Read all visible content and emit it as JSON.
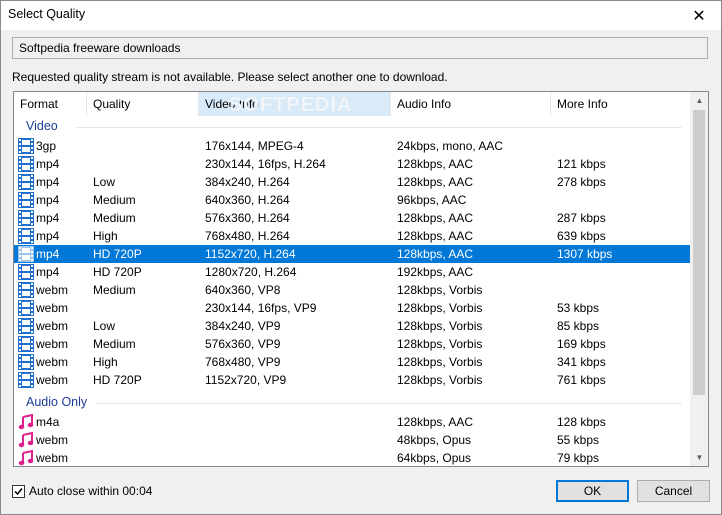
{
  "window": {
    "title": "Select Quality",
    "close_glyph": "✕"
  },
  "url_text": "Softpedia freeware downloads",
  "message": "Requested quality stream is not available. Please select another one to download.",
  "columns": [
    "Format",
    "Quality",
    "Video Info",
    "Audio Info",
    "More Info"
  ],
  "watermark": "SOFTPEDIA",
  "groups": {
    "video": "Video",
    "audio": "Audio Only"
  },
  "video_rows": [
    {
      "format": "3gp",
      "quality": "",
      "video": "176x144, MPEG-4",
      "audio": "24kbps, mono, AAC",
      "more": ""
    },
    {
      "format": "mp4",
      "quality": "",
      "video": "230x144, 16fps, H.264",
      "audio": "128kbps, AAC",
      "more": "121 kbps"
    },
    {
      "format": "mp4",
      "quality": "Low",
      "video": "384x240, H.264",
      "audio": "128kbps, AAC",
      "more": "278 kbps"
    },
    {
      "format": "mp4",
      "quality": "Medium",
      "video": "640x360, H.264",
      "audio": "96kbps, AAC",
      "more": ""
    },
    {
      "format": "mp4",
      "quality": "Medium",
      "video": "576x360, H.264",
      "audio": "128kbps, AAC",
      "more": "287 kbps"
    },
    {
      "format": "mp4",
      "quality": "High",
      "video": "768x480, H.264",
      "audio": "128kbps, AAC",
      "more": "639 kbps"
    },
    {
      "format": "mp4",
      "quality": "HD 720P",
      "video": "1152x720, H.264",
      "audio": "128kbps, AAC",
      "more": "1307 kbps"
    },
    {
      "format": "mp4",
      "quality": "HD 720P",
      "video": "1280x720, H.264",
      "audio": "192kbps, AAC",
      "more": ""
    },
    {
      "format": "webm",
      "quality": "Medium",
      "video": "640x360, VP8",
      "audio": "128kbps, Vorbis",
      "more": ""
    },
    {
      "format": "webm",
      "quality": "",
      "video": "230x144, 16fps, VP9",
      "audio": "128kbps, Vorbis",
      "more": "53 kbps"
    },
    {
      "format": "webm",
      "quality": "Low",
      "video": "384x240, VP9",
      "audio": "128kbps, Vorbis",
      "more": "85 kbps"
    },
    {
      "format": "webm",
      "quality": "Medium",
      "video": "576x360, VP9",
      "audio": "128kbps, Vorbis",
      "more": "169 kbps"
    },
    {
      "format": "webm",
      "quality": "High",
      "video": "768x480, VP9",
      "audio": "128kbps, Vorbis",
      "more": "341 kbps"
    },
    {
      "format": "webm",
      "quality": "HD 720P",
      "video": "1152x720, VP9",
      "audio": "128kbps, Vorbis",
      "more": "761 kbps"
    }
  ],
  "audio_rows": [
    {
      "format": "m4a",
      "quality": "",
      "video": "",
      "audio": "128kbps, AAC",
      "more": "128 kbps"
    },
    {
      "format": "webm",
      "quality": "",
      "video": "",
      "audio": "48kbps, Opus",
      "more": "55 kbps"
    },
    {
      "format": "webm",
      "quality": "",
      "video": "",
      "audio": "64kbps, Opus",
      "more": "79 kbps"
    }
  ],
  "selected_video_row": 6,
  "auto_close": {
    "label": "Auto close within 00:04",
    "checked": true
  },
  "buttons": {
    "ok": "OK",
    "cancel": "Cancel"
  },
  "colors": {
    "selection": "#0078d7",
    "video_icon": "#1f6fd0",
    "audio_icon": "#e0208c",
    "group_text": "#1e3c96"
  },
  "icons": {
    "video": "film-icon",
    "audio": "music-note-icon"
  }
}
